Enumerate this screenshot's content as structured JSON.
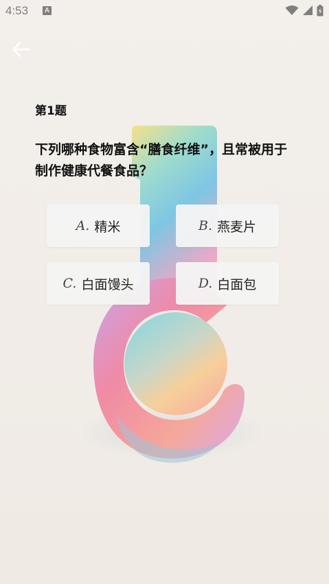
{
  "status_bar": {
    "time": "4:53",
    "notification_icon": "a-icon",
    "icons": [
      "wifi-icon",
      "cell-signal-icon",
      "battery-icon"
    ]
  },
  "nav": {
    "back_icon": "arrow-left-icon"
  },
  "question": {
    "number_label": "第1题",
    "text": "下列哪种食物富含“膳食纤维”，且常被用于制作健康代餐食品？"
  },
  "options": [
    {
      "letter": "A.",
      "text": "精米"
    },
    {
      "letter": "B.",
      "text": "燕麦片"
    },
    {
      "letter": "C.",
      "text": "白面馒头"
    },
    {
      "letter": "D.",
      "text": "白面包"
    }
  ],
  "colors": {
    "background": "#f2ede8",
    "text": "#111111",
    "option_bg": "#f4f4f4",
    "status_icons": "#7f7f7f"
  }
}
